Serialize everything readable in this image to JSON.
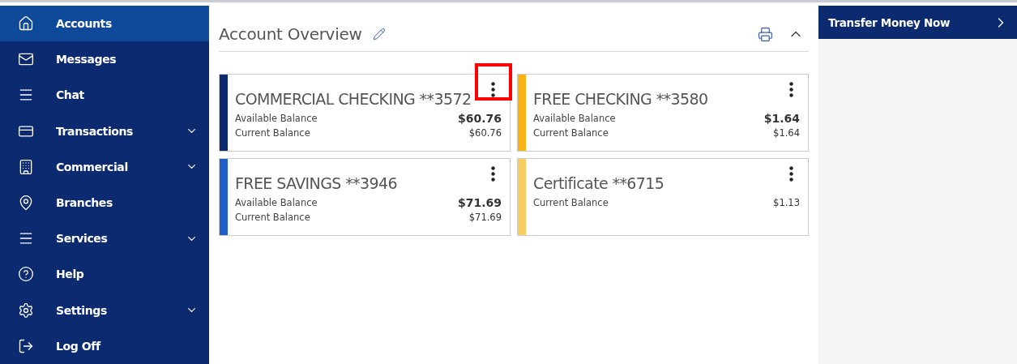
{
  "sidebar": {
    "items": [
      {
        "label": "Accounts",
        "selected": true,
        "expandable": false
      },
      {
        "label": "Messages",
        "selected": false,
        "expandable": false
      },
      {
        "label": "Chat",
        "selected": false,
        "expandable": false
      },
      {
        "label": "Transactions",
        "selected": false,
        "expandable": true
      },
      {
        "label": "Commercial",
        "selected": false,
        "expandable": true
      },
      {
        "label": "Branches",
        "selected": false,
        "expandable": false
      },
      {
        "label": "Services",
        "selected": false,
        "expandable": true
      },
      {
        "label": "Help",
        "selected": false,
        "expandable": false
      },
      {
        "label": "Settings",
        "selected": false,
        "expandable": true
      },
      {
        "label": "Log Off",
        "selected": false,
        "expandable": false
      }
    ]
  },
  "overview": {
    "title": "Account Overview",
    "accounts": [
      {
        "name": "COMMERCIAL CHECKING **3572",
        "color": "#0b2a6f",
        "menu_highlighted": true,
        "balances": [
          {
            "kind": "available",
            "label": "Available Balance",
            "amount": "$60.76"
          },
          {
            "kind": "current",
            "label": "Current Balance",
            "amount": "$60.76"
          }
        ]
      },
      {
        "name": "FREE CHECKING **3580",
        "color": "#fbb217",
        "menu_highlighted": false,
        "balances": [
          {
            "kind": "available",
            "label": "Available Balance",
            "amount": "$1.64"
          },
          {
            "kind": "current",
            "label": "Current Balance",
            "amount": "$1.64"
          }
        ]
      },
      {
        "name": "FREE SAVINGS **3946",
        "color": "#1f5fc6",
        "menu_highlighted": false,
        "balances": [
          {
            "kind": "available",
            "label": "Available Balance",
            "amount": "$71.69"
          },
          {
            "kind": "current",
            "label": "Current Balance",
            "amount": "$71.69"
          }
        ]
      },
      {
        "name": "Certificate **6715",
        "color": "#f7cd62",
        "menu_highlighted": false,
        "balances": [
          {
            "kind": "current",
            "label": "Current Balance",
            "amount": "$1.13"
          }
        ]
      }
    ]
  },
  "transfer": {
    "label": "Transfer Money Now"
  }
}
